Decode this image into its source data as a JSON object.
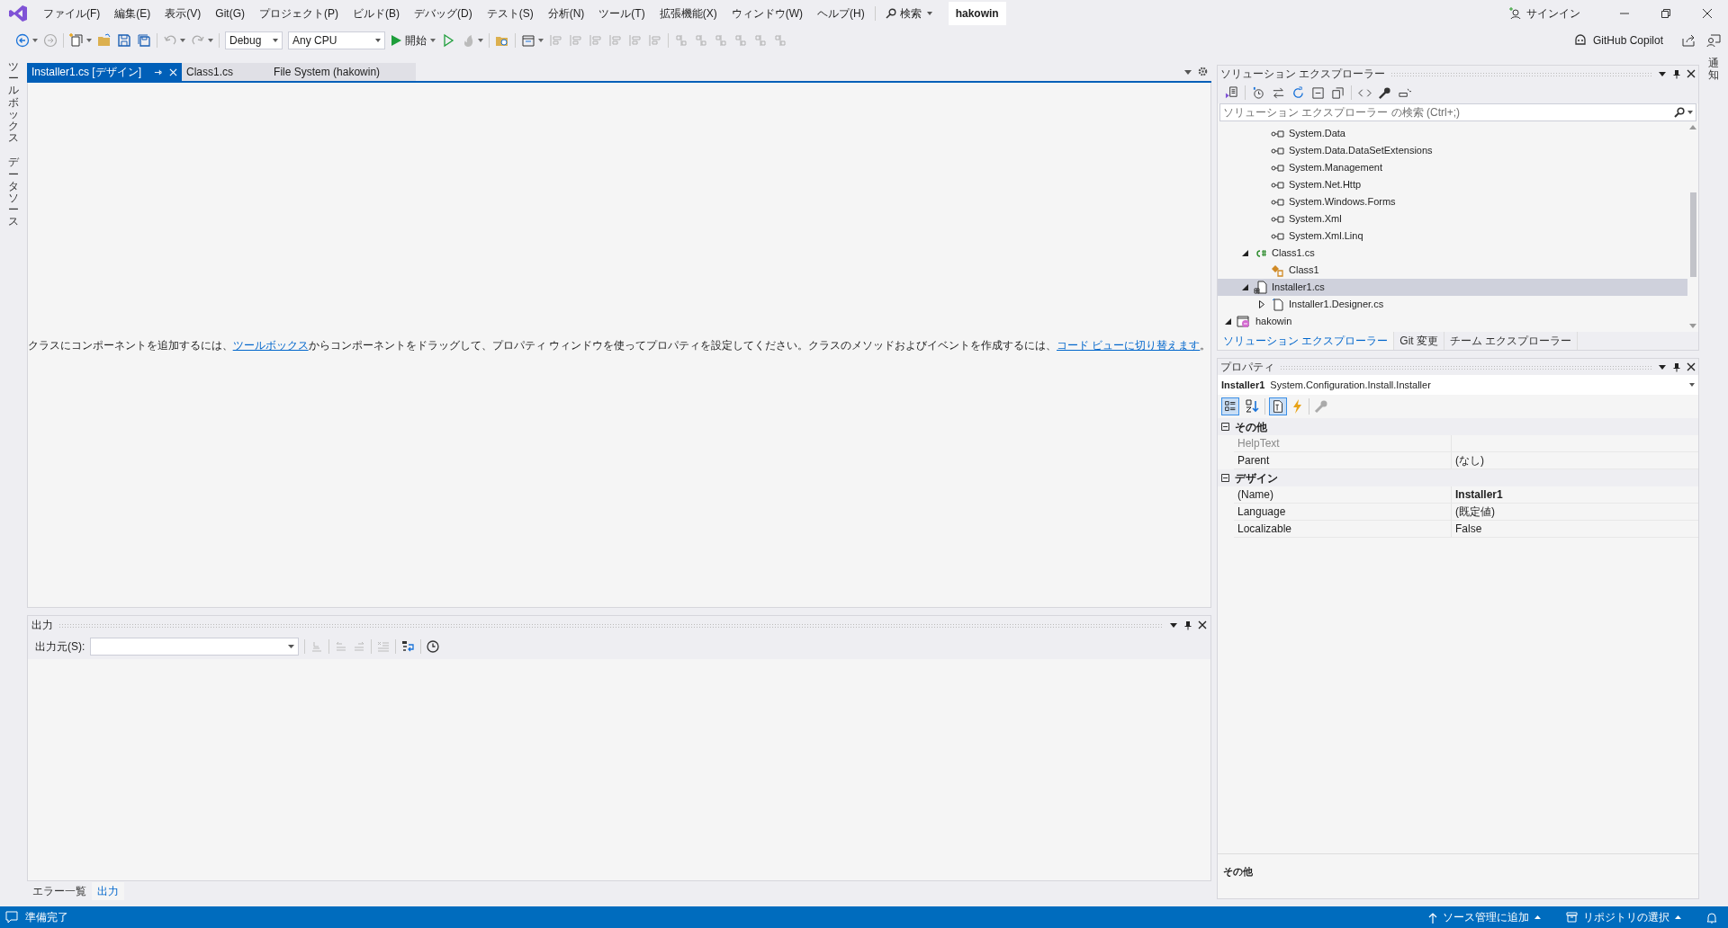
{
  "menu": [
    "ファイル(F)",
    "編集(E)",
    "表示(V)",
    "Git(G)",
    "プロジェクト(P)",
    "ビルド(B)",
    "デバッグ(D)",
    "テスト(S)",
    "分析(N)",
    "ツール(T)",
    "拡張機能(X)",
    "ウィンドウ(W)",
    "ヘルプ(H)"
  ],
  "search_label": "検索",
  "solution_name": "hakowin",
  "sign_in": "サインイン",
  "toolbar": {
    "configuration": "Debug",
    "platform": "Any CPU",
    "start": "開始"
  },
  "copilot": "GitHub Copilot",
  "left_strip": [
    "ツールボックス",
    "データソース"
  ],
  "right_strip": [
    "通知"
  ],
  "doc_tabs": [
    {
      "label": "Installer1.cs [デザイン]",
      "selected": true
    },
    {
      "label": "Class1.cs",
      "selected": false
    },
    {
      "label": "File System (hakowin)",
      "selected": false
    }
  ],
  "designer": {
    "message": [
      {
        "kind": "text",
        "text": "クラスにコンポーネントを追加するには、"
      },
      {
        "kind": "link",
        "text": "ツールボックス"
      },
      {
        "kind": "text",
        "text": "からコンポーネントをドラッグして、プロパティ ウィンドウを使ってプロパティを設定してください。クラスのメソッドおよびイベントを作成するには、"
      },
      {
        "kind": "link",
        "text": "コード ビューに切り替えます"
      },
      {
        "kind": "text",
        "text": "。"
      }
    ]
  },
  "output": {
    "title": "出力",
    "source_label": "出力元(S):"
  },
  "bottom_tabs": [
    {
      "label": "エラー一覧",
      "selected": false
    },
    {
      "label": "出力",
      "selected": true
    }
  ],
  "solution_explorer": {
    "title": "ソリューション エクスプローラー",
    "search_placeholder": "ソリューション エクスプローラー の検索 (Ctrl+;)",
    "tree": [
      {
        "name": "System.Data",
        "kind": "reference",
        "selected": false
      },
      {
        "name": "System.Data.DataSetExtensions",
        "kind": "reference",
        "selected": false
      },
      {
        "name": "System.Management",
        "kind": "reference",
        "selected": false
      },
      {
        "name": "System.Net.Http",
        "kind": "reference",
        "selected": false
      },
      {
        "name": "System.Windows.Forms",
        "kind": "reference",
        "selected": false
      },
      {
        "name": "System.Xml",
        "kind": "reference",
        "selected": false
      },
      {
        "name": "System.Xml.Linq",
        "kind": "reference",
        "selected": false
      },
      {
        "name": "Class1.cs",
        "kind": "csharp",
        "selected": false,
        "expanded": true,
        "children": [
          {
            "name": "Class1",
            "kind": "class",
            "selected": false
          }
        ]
      },
      {
        "name": "Installer1.cs",
        "kind": "component",
        "selected": true,
        "expanded": true,
        "children": [
          {
            "name": "Installer1.Designer.cs",
            "kind": "file",
            "selected": false,
            "expanded": false
          }
        ]
      },
      {
        "name": "hakowin",
        "kind": "project",
        "selected": false,
        "expanded": true
      }
    ],
    "tabs": [
      {
        "label": "ソリューション エクスプローラー",
        "selected": true
      },
      {
        "label": "Git 変更",
        "selected": false
      },
      {
        "label": "チーム エクスプローラー",
        "selected": false
      }
    ]
  },
  "properties": {
    "title": "プロパティ",
    "object_name": "Installer1",
    "object_type": "System.Configuration.Install.Installer",
    "categories": [
      {
        "name": "その他",
        "expanded": true,
        "rows": [
          {
            "name": "HelpText",
            "disabled": true
          },
          {
            "name": "Parent",
            "value": "(なし)",
            "disabled": false,
            "bold": false
          }
        ]
      },
      {
        "name": "デザイン",
        "expanded": true,
        "rows": [
          {
            "name": "(Name)",
            "value": "Installer1",
            "disabled": false,
            "bold": true
          },
          {
            "name": "Language",
            "value": "(既定値)",
            "disabled": false,
            "bold": false
          },
          {
            "name": "Localizable",
            "value": "False",
            "disabled": false,
            "bold": false
          }
        ]
      }
    ],
    "description_title": "その他"
  },
  "status_bar": {
    "text": "準備完了",
    "source_control": "ソース管理に追加",
    "repository": "リポジトリの選択"
  }
}
